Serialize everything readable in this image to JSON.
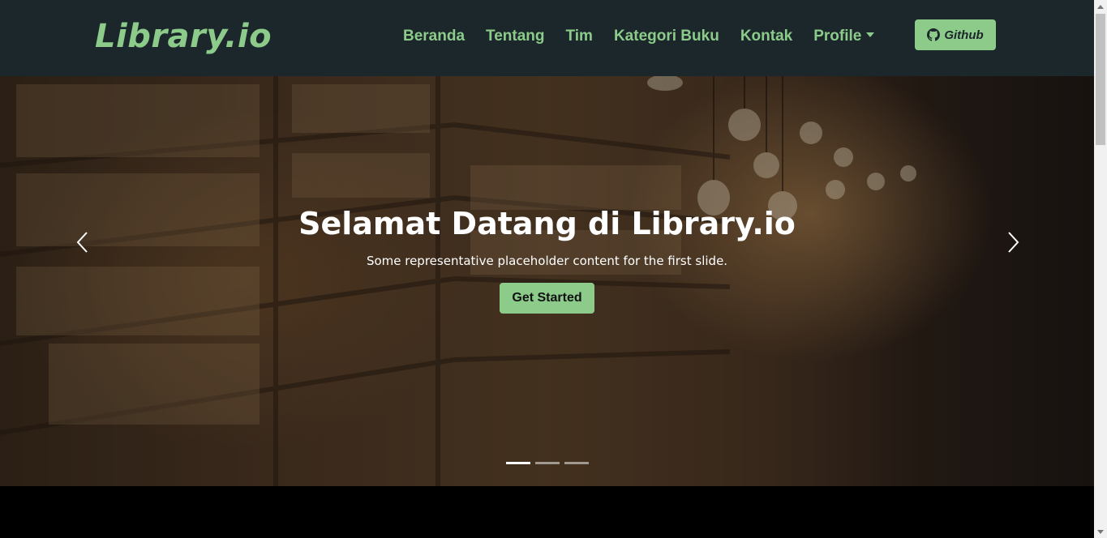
{
  "brand": {
    "name": "Library.io"
  },
  "nav": {
    "items": [
      {
        "label": "Beranda"
      },
      {
        "label": "Tentang"
      },
      {
        "label": "Tim"
      },
      {
        "label": "Kategori Buku"
      },
      {
        "label": "Kontak"
      },
      {
        "label": "Profile"
      }
    ],
    "github_label": "Github"
  },
  "hero": {
    "title": "Selamat Datang di Library.io",
    "subtitle": "Some representative placeholder content for the first slide.",
    "cta_label": "Get Started",
    "slides_count": 3,
    "active_slide": 1
  },
  "colors": {
    "accent": "#8ccb8a",
    "navbar_bg": "#1b272b"
  },
  "icons": [
    "github-icon",
    "chevron-left-icon",
    "chevron-right-icon",
    "caret-down-icon"
  ]
}
